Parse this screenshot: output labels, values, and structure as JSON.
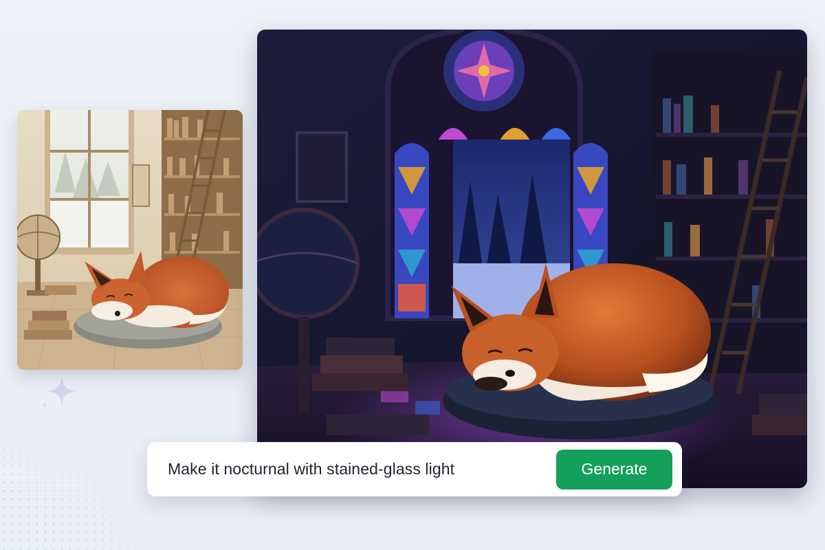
{
  "prompt": {
    "value": "Make it nocturnal with stained-glass light"
  },
  "generate_button": {
    "label": "Generate"
  },
  "colors": {
    "accent": "#14a05a",
    "background": "#eef1f7",
    "prompt_text": "#1e2230"
  },
  "icons": {
    "sparkle": "sparkle-icon"
  }
}
